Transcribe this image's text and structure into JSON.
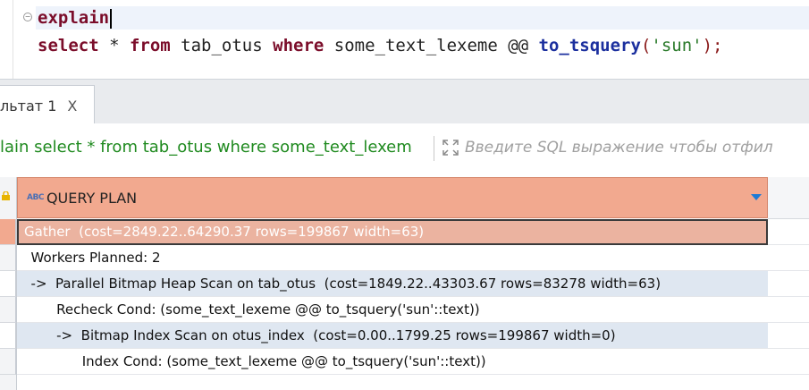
{
  "editor": {
    "line1_keyword": "explain",
    "line2": {
      "select": "select",
      "star": " * ",
      "from": "from",
      "table": " tab_otus ",
      "where": "where",
      "column": " some_text_lexeme @@ ",
      "func": "to_tsquery",
      "open": "(",
      "arg": "'sun'",
      "close": ");"
    }
  },
  "result_tab": {
    "label": "льтат 1",
    "close": "X"
  },
  "filter_bar": {
    "query_text": "lain select * from tab_otus where some_text_lexem",
    "placeholder": "Введите SQL выражение чтобы отфил"
  },
  "grid": {
    "column_header": "QUERY PLAN",
    "type_badge": "ABC",
    "rows": [
      "Gather  (cost=2849.22..64290.37 rows=199867 width=63)",
      "  Workers Planned: 2",
      "  ->  Parallel Bitmap Heap Scan on tab_otus  (cost=1849.22..43303.67 rows=83278 width=63)",
      "        Recheck Cond: (some_text_lexeme @@ to_tsquery('sun'::text))",
      "        ->  Bitmap Index Scan on otus_index  (cost=0.00..1799.25 rows=199867 width=0)",
      "              Index Cond: (some_text_lexeme @@ to_tsquery('sun'::text))"
    ]
  },
  "colors": {
    "header_bg": "#f2a98f",
    "selected_row_bg": "#ebb3a0",
    "alt_row_bg": "#dfe7f1",
    "keyword": "#7b0d2a",
    "function": "#1b2f9e",
    "string": "#2a7a2a",
    "query_text": "#1f8a1f"
  }
}
